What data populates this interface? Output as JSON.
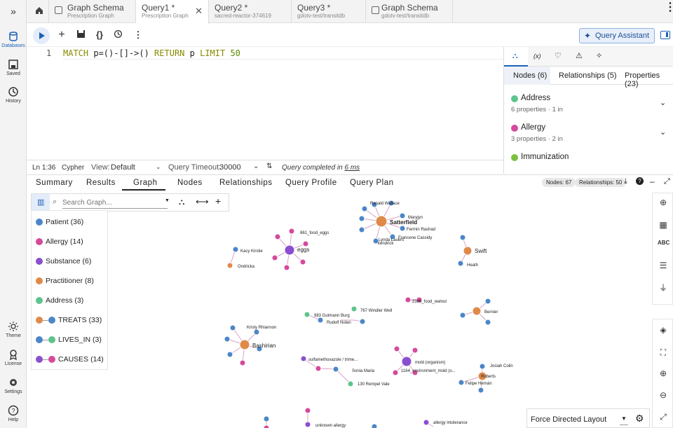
{
  "rail": [
    {
      "label": "Databases",
      "icon": "database-icon"
    },
    {
      "label": "Saved",
      "icon": "save-icon"
    },
    {
      "label": "History",
      "icon": "history-icon"
    },
    {
      "label": "Theme",
      "icon": "theme-icon"
    },
    {
      "label": "License",
      "icon": "license-icon"
    },
    {
      "label": "Settings",
      "icon": "gear-icon"
    },
    {
      "label": "Help",
      "icon": "help-icon"
    }
  ],
  "tabs": [
    {
      "title": "Graph Schema",
      "sub": "Prescription Graph"
    },
    {
      "title": "Query1 *",
      "sub": "Prescription Graph"
    },
    {
      "title": "Query2 *",
      "sub": "sacred-reactor-374619"
    },
    {
      "title": "Query3 *",
      "sub": "gdotv-test/transitdb"
    },
    {
      "title": "Graph Schema",
      "sub": "gdotv-test/transitdb"
    }
  ],
  "toolbar": {
    "query_assistant": "Query Assistant",
    "braces": "{}"
  },
  "editor": {
    "line_no": "1",
    "kw1": "MATCH",
    "p1": " p=()-[]->() ",
    "kw2": "RETURN",
    "p2": " p ",
    "kw3": "LIMIT",
    "p3": " 50"
  },
  "status": {
    "pos": "Ln 1:36",
    "lang": "Cypher",
    "view_label": "View:",
    "view_value": "Default",
    "timeout_label": "Query Timeout:",
    "timeout_value": "30000",
    "completed": "Query completed in",
    "completed_time": "6 ms"
  },
  "side": {
    "icons": [
      "graph-icon",
      "variable-icon",
      "bulb-icon",
      "warning-icon",
      "sparkle-icon"
    ],
    "var_label": "(x)",
    "tabs": [
      "Nodes (6)",
      "Relationships (5)",
      "Properties (23)"
    ],
    "items": [
      {
        "name": "Address",
        "meta": "6 properties · 1 in",
        "color": "#5dc48c"
      },
      {
        "name": "Allergy",
        "meta": "3 properties · 2 in",
        "color": "#d44a9c"
      },
      {
        "name": "Immunization",
        "meta": "",
        "color": "#7bc043"
      }
    ]
  },
  "result_tabs": [
    "Summary",
    "Results",
    "Graph",
    "Nodes",
    "Relationships",
    "Query Profile",
    "Query Plan"
  ],
  "badges": {
    "nodes": "Nodes: 67",
    "relationships": "Relationships: 50"
  },
  "search": {
    "placeholder": "Search Graph..."
  },
  "legend": [
    {
      "label": "Patient (36)",
      "color": "#4b86c8"
    },
    {
      "label": "Allergy (14)",
      "color": "#d44a9c"
    },
    {
      "label": "Substance (6)",
      "color": "#8a4fd0"
    },
    {
      "label": "Practitioner (8)",
      "color": "#e08a4a"
    },
    {
      "label": "Address (3)",
      "color": "#5dc48c"
    },
    {
      "label": "TREATS (33)",
      "from": "#e08a4a",
      "to": "#4b86c8"
    },
    {
      "label": "LIVES_IN (3)",
      "from": "#4b86c8",
      "to": "#5dc48c"
    },
    {
      "label": "CAUSES (14)",
      "from": "#8a4fd0",
      "to": "#d44a9c"
    }
  ],
  "layout": {
    "value": "Force Directed Layout"
  },
  "graph_labels": {
    "ronald": "Ronald Wallace",
    "maryjyn": "Maryjyn",
    "satterfield": "Satterfield",
    "fermin": "Fermin Rashad",
    "lynda": "Lynda Lauers",
    "francene": "Francene Cassidy",
    "kendrick": "kendrick",
    "food_eggs": "861_food_eggs",
    "eggs": "eggs",
    "kacy": "Kacy Kirstie",
    "ondricka": "Ondricka",
    "swift": "Swift",
    "heath": "Heath",
    "windler": "767 Windler Well",
    "gutmann": "983 Gutmann Burg",
    "rudolf": "Rudolf Nolan",
    "walnut": "2366_food_walnut",
    "bernier": "Bernier",
    "kristy": "Kristy Rhiannon",
    "bashirian": "Bashirian",
    "sulfa": "sulfamethoxazole / trime...",
    "sonia": "Sonia Maria",
    "rempel": "130 Rempel Vale",
    "mold": "mold (organism)",
    "mold_env": "1164_environment_mold (o...",
    "josiah": "Josiah Colin",
    "roberts": "Roberts",
    "felipe": "Felipe Hernán",
    "unknown": "unknown allergy",
    "intol": "allergy intolerance"
  }
}
